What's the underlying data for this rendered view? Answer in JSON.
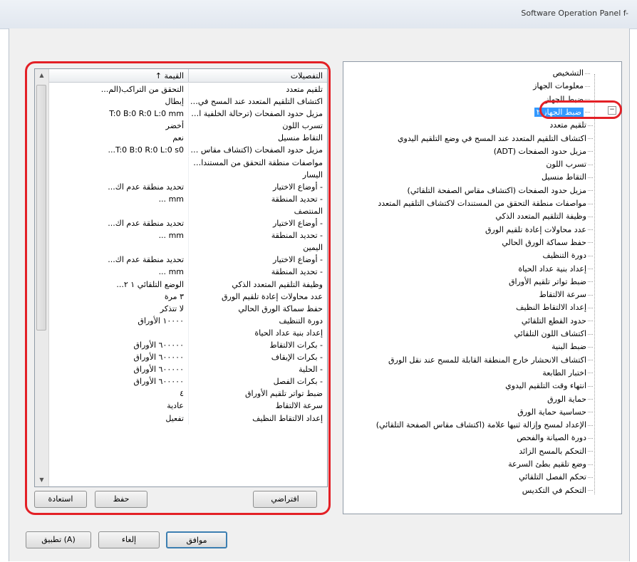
{
  "window": {
    "title": "Software Operation Panel f-"
  },
  "grid": {
    "headers": {
      "settings": "التفصيلات",
      "value": "القيمة ↑"
    },
    "rows": [
      {
        "name": "تلقيم متعدد",
        "value": "التحقق من التراكب(الم..."
      },
      {
        "name": "اكتشاف التلقيم المتعدد عند المسح في و...",
        "value": "إبطال"
      },
      {
        "name": "مزيل حدود الصفحات (ترحالة الخلفية الثقا...",
        "value": "T:0 B:0 R:0 L:0 mm"
      },
      {
        "name": "تسرب اللون",
        "value": "أخضر"
      },
      {
        "name": "التقاط منسيل",
        "value": "نعم"
      },
      {
        "name": "مزيل حدود الصفحات (اكتشاف مقاس الصفح...",
        "value": "T:0 B:0 R:0 L:0 s0..."
      },
      {
        "name": "مواصفات منطقة التحقق من المستندات ذات...",
        "value": ""
      },
      {
        "name": "اليسار",
        "value": ""
      },
      {
        "name": "- أوضاع الاختيار",
        "value": "تحديد منطقة عدم اك..."
      },
      {
        "name": "- تحديد المنطقة",
        "value": "mm ..."
      },
      {
        "name": "المنتصف",
        "value": ""
      },
      {
        "name": "- أوضاع الاختيار",
        "value": "تحديد منطقة عدم اك..."
      },
      {
        "name": "- تحديد المنطقة",
        "value": "mm ..."
      },
      {
        "name": "اليمين",
        "value": ""
      },
      {
        "name": "- أوضاع الاختيار",
        "value": "تحديد منطقة عدم اك..."
      },
      {
        "name": "- تحديد المنطقة",
        "value": "mm ..."
      },
      {
        "name": "وظيفة التلقيم المتعدد الذكي",
        "value": "الوضع التلقائي ١ ٢..."
      },
      {
        "name": "عدد محاولات إعادة تلقيم الورق",
        "value": "٣ مرة"
      },
      {
        "name": "حفظ سماكة الورق الحالي",
        "value": "لا تتذكر"
      },
      {
        "name": "دورة التنظيف",
        "value": "١٠٠٠٠ الأوراق"
      },
      {
        "name": "إعداد بنية عداد الحياة",
        "value": ""
      },
      {
        "name": "- بكرات الالتقاط",
        "value": "٦٠٠٠٠٠ الأوراق"
      },
      {
        "name": "- بكرات الإيقاف",
        "value": "٦٠٠٠٠٠ الأوراق"
      },
      {
        "name": "- الحلية",
        "value": "٦٠٠٠٠٠ الأوراق"
      },
      {
        "name": "- بكرات الفصل",
        "value": "٦٠٠٠٠٠ الأوراق"
      },
      {
        "name": "ضبط تواتر تلقيم الأوراق",
        "value": "٤"
      },
      {
        "name": "سرعة الالتقاط",
        "value": "عادية"
      },
      {
        "name": "إعداد الالتقاط النظيف",
        "value": "تفعيل"
      }
    ]
  },
  "buttons": {
    "restore": "استعادة",
    "save": "حفظ",
    "defaults": "افتراضي",
    "ok": "موافق",
    "cancel": "إلغاء",
    "apply": "تطبيق (A)"
  },
  "tree": {
    "items": [
      {
        "label": "التشخيص",
        "level": 0
      },
      {
        "label": "معلومات الجهاز",
        "level": 0
      },
      {
        "label": "ضبط الجهاز",
        "level": 0
      },
      {
        "label": "ضبط الجهاز ٢",
        "level": 0,
        "selected": true
      },
      {
        "label": "تلقيم متعدد",
        "level": 1
      },
      {
        "label": "اكتشاف التلقيم المتعدد عند المسح في وضع التلقيم اليدوي",
        "level": 1
      },
      {
        "label": "مزيل حدود الصفحات (ADT)",
        "level": 1
      },
      {
        "label": "تسرب اللون",
        "level": 1
      },
      {
        "label": "التقاط منسيل",
        "level": 1
      },
      {
        "label": "مزيل حدود الصفحات (اكتشاف مقاس الصفحة التلقائي)",
        "level": 1
      },
      {
        "label": "مواصفات منطقة التحقق من المستندات لاكتشاف التلقيم المتعدد",
        "level": 1
      },
      {
        "label": "وظيفة التلقيم المتعدد الذكي",
        "level": 1
      },
      {
        "label": "عدد محاولات إعادة تلقيم الورق",
        "level": 1
      },
      {
        "label": "حفظ سماكة الورق الحالي",
        "level": 1
      },
      {
        "label": "دورة التنظيف",
        "level": 1
      },
      {
        "label": "إعداد بنية عداد الحياة",
        "level": 1
      },
      {
        "label": "ضبط تواتر تلقيم الأوراق",
        "level": 1
      },
      {
        "label": "سرعة الالتقاط",
        "level": 1
      },
      {
        "label": "إعداد الالتقاط النظيف",
        "level": 1
      },
      {
        "label": "حدود القطع التلقائي",
        "level": 1
      },
      {
        "label": "اكتشاف اللون التلقائي",
        "level": 1
      },
      {
        "label": "ضبط البنية",
        "level": 1
      },
      {
        "label": "اكتشاف الانحشار خارج المنطقة القابلة للمسح عند نقل الورق",
        "level": 1
      },
      {
        "label": "اختبار الطابعة",
        "level": 1
      },
      {
        "label": "انتهاء وقت التلقيم اليدوي",
        "level": 1
      },
      {
        "label": "حماية الورق",
        "level": 1
      },
      {
        "label": "حساسية حماية الورق",
        "level": 1
      },
      {
        "label": "الإعداد لمسح وإزالة ثنيها علامة (اكتشاف مقاس الصفحة التلقائي)",
        "level": 1
      },
      {
        "label": "دورة الصيانة والفحص",
        "level": 1
      },
      {
        "label": "التحكم بالمسح الزائد",
        "level": 1
      },
      {
        "label": "وضع تلقيم بطئ السرعة",
        "level": 1
      },
      {
        "label": "تحكم الفصل التلقائي",
        "level": 1
      },
      {
        "label": "التحكم في التكديس",
        "level": 1
      }
    ]
  }
}
